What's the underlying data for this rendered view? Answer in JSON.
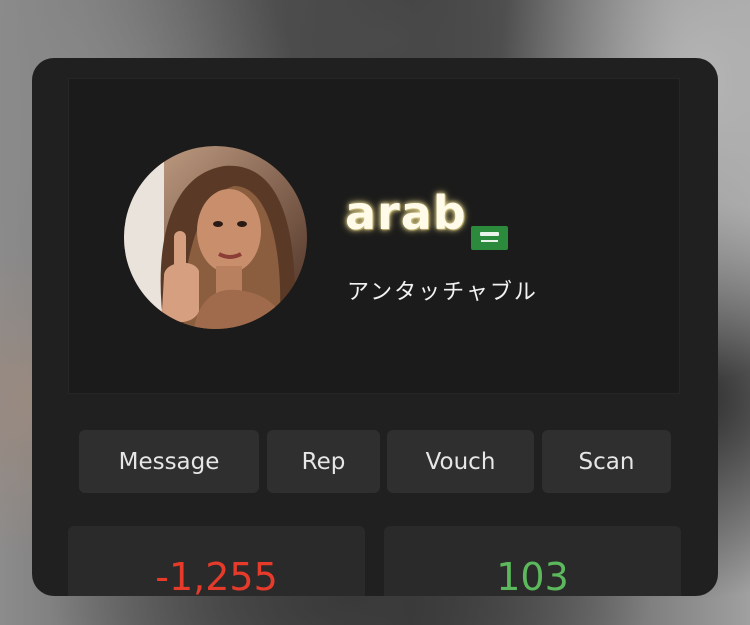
{
  "profile": {
    "username": "arab",
    "flag_icon": "saudi-arabia-flag-icon",
    "subtitle": "アンタッチャブル",
    "avatar_icon": "profile-avatar"
  },
  "actions": {
    "message_label": "Message",
    "rep_label": "Rep",
    "vouch_label": "Vouch",
    "scan_label": "Scan"
  },
  "stats": {
    "negative_value": "-1,255",
    "positive_value": "103"
  },
  "colors": {
    "card_background": "#202020",
    "button_background": "#2f2f2f",
    "negative": "#e63a2b",
    "positive": "#5cb85c",
    "flag_green": "#2b8a3b"
  }
}
